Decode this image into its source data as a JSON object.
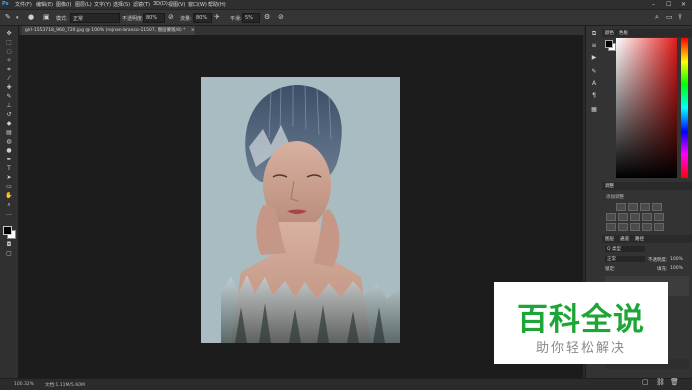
{
  "menubar": {
    "items": [
      "文件(F)",
      "编辑(E)",
      "图像(I)",
      "图层(L)",
      "文字(Y)",
      "选择(S)",
      "滤镜(T)",
      "3D(D)",
      "视图(V)",
      "窗口(W)",
      "帮助(H)"
    ],
    "window_controls": [
      "–",
      "☐",
      "✕"
    ]
  },
  "options": {
    "mode_label": "模式:",
    "mode_value": "正常",
    "opacity_label": "不透明度:",
    "opacity_value": "80%",
    "flow_label": "流量:",
    "flow_value": "80%",
    "smooth_label": "平滑:",
    "smooth_value": "5%"
  },
  "document": {
    "tab_title": "girl-1553718_960_720.jpg @ 100% (rojnan-branco-11507, 图层蒙版/8) *",
    "close": "×"
  },
  "status": {
    "zoom": "100.32%",
    "doc_info": "文档:1.11M/5.60M"
  },
  "panels": {
    "color_tabs": [
      "颜色",
      "色板"
    ],
    "adjust_tabs": [
      "调整"
    ],
    "adjust_label": "添加调整",
    "layer_tabs": [
      "图层",
      "通道",
      "路径"
    ],
    "kind_label": "Q 类型",
    "blend_mode": "正常",
    "opacity_label": "不透明度:",
    "opacity_value": "100%",
    "lock_label": "锁定:",
    "fill_label": "填充:",
    "fill_value": "100%"
  },
  "watermark": {
    "title": "百科全说",
    "subtitle": "助你轻松解决"
  },
  "colors": {
    "accent_green": "#1ea538",
    "canvas_bg": "#1c1c1c",
    "document_bg": "#a8bcc2"
  }
}
